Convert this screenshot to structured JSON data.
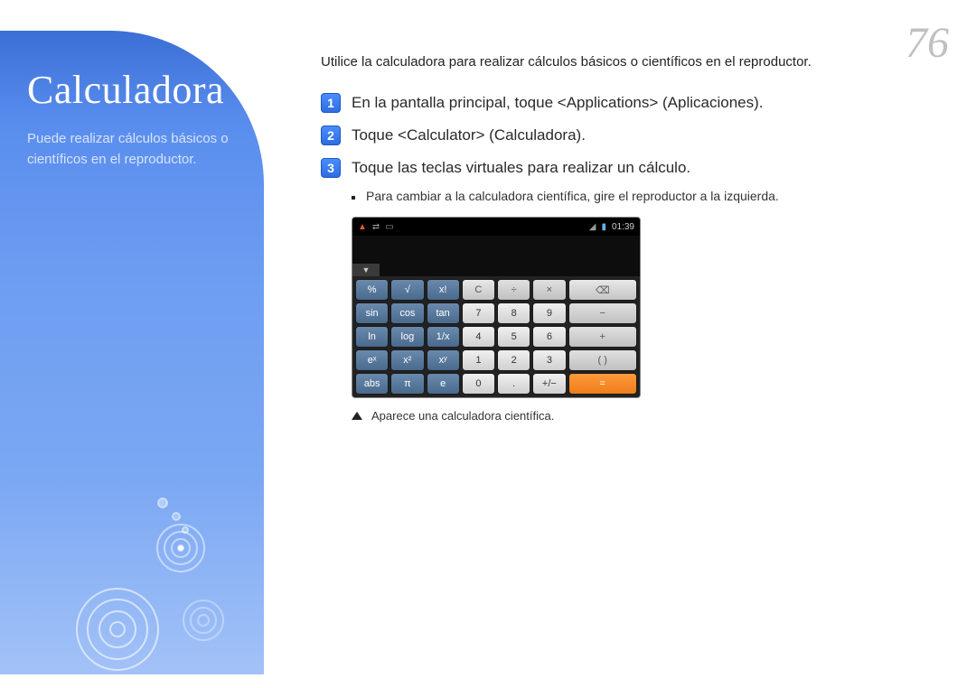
{
  "page": {
    "number": "76"
  },
  "sidebar": {
    "title": "Calculadora",
    "subtitle": "Puede realizar cálculos básicos o científicos en el reproductor."
  },
  "content": {
    "intro": "Utilice la calculadora para realizar cálculos básicos o científicos en el reproductor.",
    "steps": {
      "s1": {
        "num": "1",
        "text": "En la pantalla principal, toque <Applications> (Aplicaciones)."
      },
      "s2": {
        "num": "2",
        "text": "Toque <Calculator> (Calculadora)."
      },
      "s3": {
        "num": "3",
        "text": "Toque las teclas virtuales para realizar un cálculo."
      }
    },
    "bullet": "Para cambiar a la calculadora científica, gire el reproductor a la izquierda.",
    "caption": "Aparece una calculadora científica."
  },
  "calculator": {
    "status_time": "01:39",
    "keys": {
      "r1c1": "%",
      "r1c2": "√",
      "r1c3": "x!",
      "r1c4": "C",
      "r1c5": "÷",
      "r1c6": "×",
      "r1c7": "⌫",
      "r2c1": "sin",
      "r2c2": "cos",
      "r2c3": "tan",
      "r2c4": "7",
      "r2c5": "8",
      "r2c6": "9",
      "r2c7": "−",
      "r3c1": "ln",
      "r3c2": "log",
      "r3c3": "1/x",
      "r3c4": "4",
      "r3c5": "5",
      "r3c6": "6",
      "r3c7": "+",
      "r4c1": "eˣ",
      "r4c2": "x²",
      "r4c3": "xʸ",
      "r4c4": "1",
      "r4c5": "2",
      "r4c6": "3",
      "r4c7": "( )",
      "r5c1": "abs",
      "r5c2": "π",
      "r5c3": "e",
      "r5c4": "0",
      "r5c5": ".",
      "r5c6": "+/−",
      "r5c7": "="
    }
  }
}
